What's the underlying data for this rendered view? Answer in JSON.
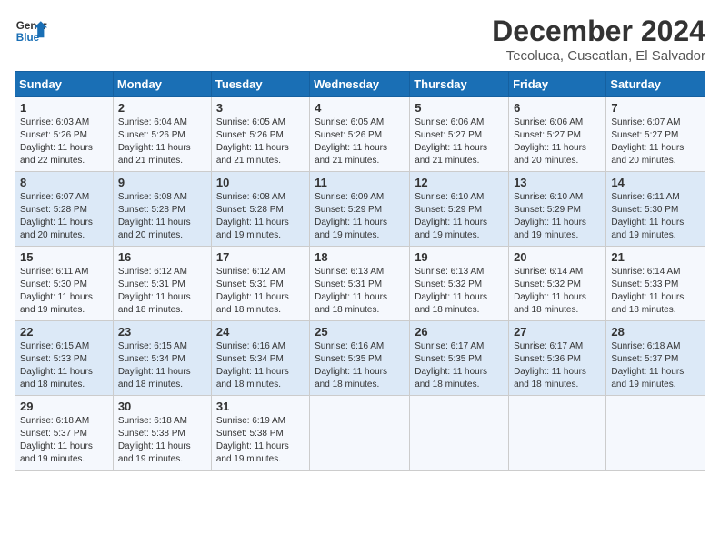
{
  "logo": {
    "text_general": "General",
    "text_blue": "Blue"
  },
  "title": "December 2024",
  "subtitle": "Tecoluca, Cuscatlan, El Salvador",
  "days_of_week": [
    "Sunday",
    "Monday",
    "Tuesday",
    "Wednesday",
    "Thursday",
    "Friday",
    "Saturday"
  ],
  "weeks": [
    [
      {
        "day": "1",
        "sunrise": "6:03 AM",
        "sunset": "5:26 PM",
        "daylight": "11 hours and 22 minutes."
      },
      {
        "day": "2",
        "sunrise": "6:04 AM",
        "sunset": "5:26 PM",
        "daylight": "11 hours and 21 minutes."
      },
      {
        "day": "3",
        "sunrise": "6:05 AM",
        "sunset": "5:26 PM",
        "daylight": "11 hours and 21 minutes."
      },
      {
        "day": "4",
        "sunrise": "6:05 AM",
        "sunset": "5:26 PM",
        "daylight": "11 hours and 21 minutes."
      },
      {
        "day": "5",
        "sunrise": "6:06 AM",
        "sunset": "5:27 PM",
        "daylight": "11 hours and 21 minutes."
      },
      {
        "day": "6",
        "sunrise": "6:06 AM",
        "sunset": "5:27 PM",
        "daylight": "11 hours and 20 minutes."
      },
      {
        "day": "7",
        "sunrise": "6:07 AM",
        "sunset": "5:27 PM",
        "daylight": "11 hours and 20 minutes."
      }
    ],
    [
      {
        "day": "8",
        "sunrise": "6:07 AM",
        "sunset": "5:28 PM",
        "daylight": "11 hours and 20 minutes."
      },
      {
        "day": "9",
        "sunrise": "6:08 AM",
        "sunset": "5:28 PM",
        "daylight": "11 hours and 20 minutes."
      },
      {
        "day": "10",
        "sunrise": "6:08 AM",
        "sunset": "5:28 PM",
        "daylight": "11 hours and 19 minutes."
      },
      {
        "day": "11",
        "sunrise": "6:09 AM",
        "sunset": "5:29 PM",
        "daylight": "11 hours and 19 minutes."
      },
      {
        "day": "12",
        "sunrise": "6:10 AM",
        "sunset": "5:29 PM",
        "daylight": "11 hours and 19 minutes."
      },
      {
        "day": "13",
        "sunrise": "6:10 AM",
        "sunset": "5:29 PM",
        "daylight": "11 hours and 19 minutes."
      },
      {
        "day": "14",
        "sunrise": "6:11 AM",
        "sunset": "5:30 PM",
        "daylight": "11 hours and 19 minutes."
      }
    ],
    [
      {
        "day": "15",
        "sunrise": "6:11 AM",
        "sunset": "5:30 PM",
        "daylight": "11 hours and 19 minutes."
      },
      {
        "day": "16",
        "sunrise": "6:12 AM",
        "sunset": "5:31 PM",
        "daylight": "11 hours and 18 minutes."
      },
      {
        "day": "17",
        "sunrise": "6:12 AM",
        "sunset": "5:31 PM",
        "daylight": "11 hours and 18 minutes."
      },
      {
        "day": "18",
        "sunrise": "6:13 AM",
        "sunset": "5:31 PM",
        "daylight": "11 hours and 18 minutes."
      },
      {
        "day": "19",
        "sunrise": "6:13 AM",
        "sunset": "5:32 PM",
        "daylight": "11 hours and 18 minutes."
      },
      {
        "day": "20",
        "sunrise": "6:14 AM",
        "sunset": "5:32 PM",
        "daylight": "11 hours and 18 minutes."
      },
      {
        "day": "21",
        "sunrise": "6:14 AM",
        "sunset": "5:33 PM",
        "daylight": "11 hours and 18 minutes."
      }
    ],
    [
      {
        "day": "22",
        "sunrise": "6:15 AM",
        "sunset": "5:33 PM",
        "daylight": "11 hours and 18 minutes."
      },
      {
        "day": "23",
        "sunrise": "6:15 AM",
        "sunset": "5:34 PM",
        "daylight": "11 hours and 18 minutes."
      },
      {
        "day": "24",
        "sunrise": "6:16 AM",
        "sunset": "5:34 PM",
        "daylight": "11 hours and 18 minutes."
      },
      {
        "day": "25",
        "sunrise": "6:16 AM",
        "sunset": "5:35 PM",
        "daylight": "11 hours and 18 minutes."
      },
      {
        "day": "26",
        "sunrise": "6:17 AM",
        "sunset": "5:35 PM",
        "daylight": "11 hours and 18 minutes."
      },
      {
        "day": "27",
        "sunrise": "6:17 AM",
        "sunset": "5:36 PM",
        "daylight": "11 hours and 18 minutes."
      },
      {
        "day": "28",
        "sunrise": "6:18 AM",
        "sunset": "5:37 PM",
        "daylight": "11 hours and 19 minutes."
      }
    ],
    [
      {
        "day": "29",
        "sunrise": "6:18 AM",
        "sunset": "5:37 PM",
        "daylight": "11 hours and 19 minutes."
      },
      {
        "day": "30",
        "sunrise": "6:18 AM",
        "sunset": "5:38 PM",
        "daylight": "11 hours and 19 minutes."
      },
      {
        "day": "31",
        "sunrise": "6:19 AM",
        "sunset": "5:38 PM",
        "daylight": "11 hours and 19 minutes."
      },
      null,
      null,
      null,
      null
    ]
  ]
}
